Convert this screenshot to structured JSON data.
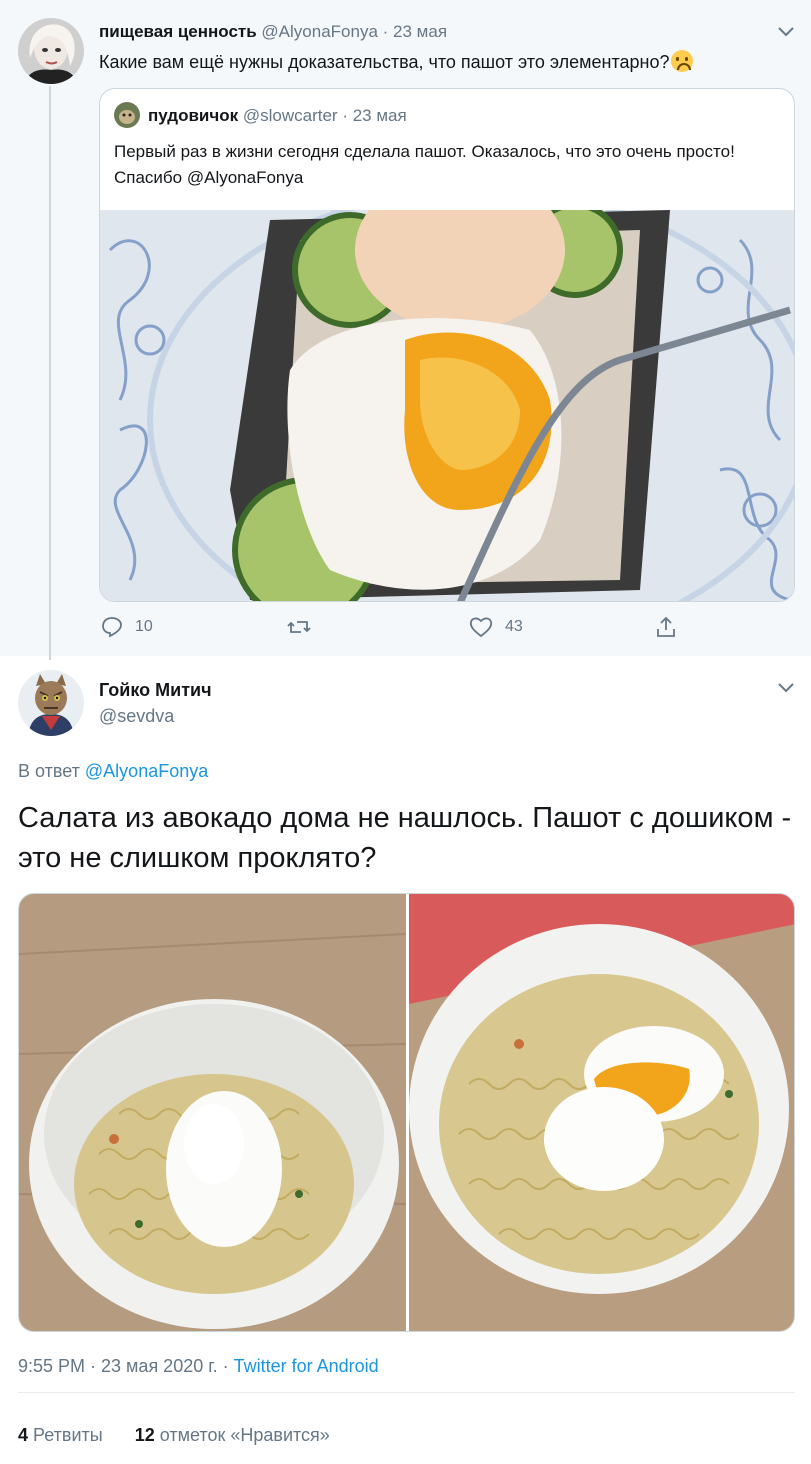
{
  "parent_tweet": {
    "author_name": "пищевая ценность",
    "author_handle": "@AlyonaFonya",
    "date": "· 23 мая",
    "text": "Какие вам ещё нужны доказательства, что пашот это элементарно?",
    "emoji": "upside-down-face",
    "quoted_tweet": {
      "author_name": "пудовичок",
      "author_handle": "@slowcarter",
      "date": "· 23 мая",
      "text": "Первый раз в жизни сегодня сделала пашот. Оказалось, что это очень просто! Спасибо @AlyonaFonya"
    },
    "actions": {
      "reply_count": "10",
      "like_count": "43"
    }
  },
  "main_tweet": {
    "author_name": "Гойко Митич",
    "author_handle": "@sevdva",
    "reply_prefix": "В ответ",
    "reply_to": "@AlyonaFonya",
    "text": "Салата из авокадо дома не нашлось. Пашот с дошиком - это не слишком проклято?",
    "time": "9:55 PM · 23 мая 2020 г. · ",
    "source": "Twitter for Android",
    "retweet_count": "4",
    "retweet_label": "Ретвиты",
    "like_count": "12",
    "like_label": "отметок «Нравится»"
  },
  "colors": {
    "accent": "#1b95e0",
    "muted": "#657786",
    "border": "#ccd6dd",
    "parent_bg": "#f5f8fa"
  }
}
